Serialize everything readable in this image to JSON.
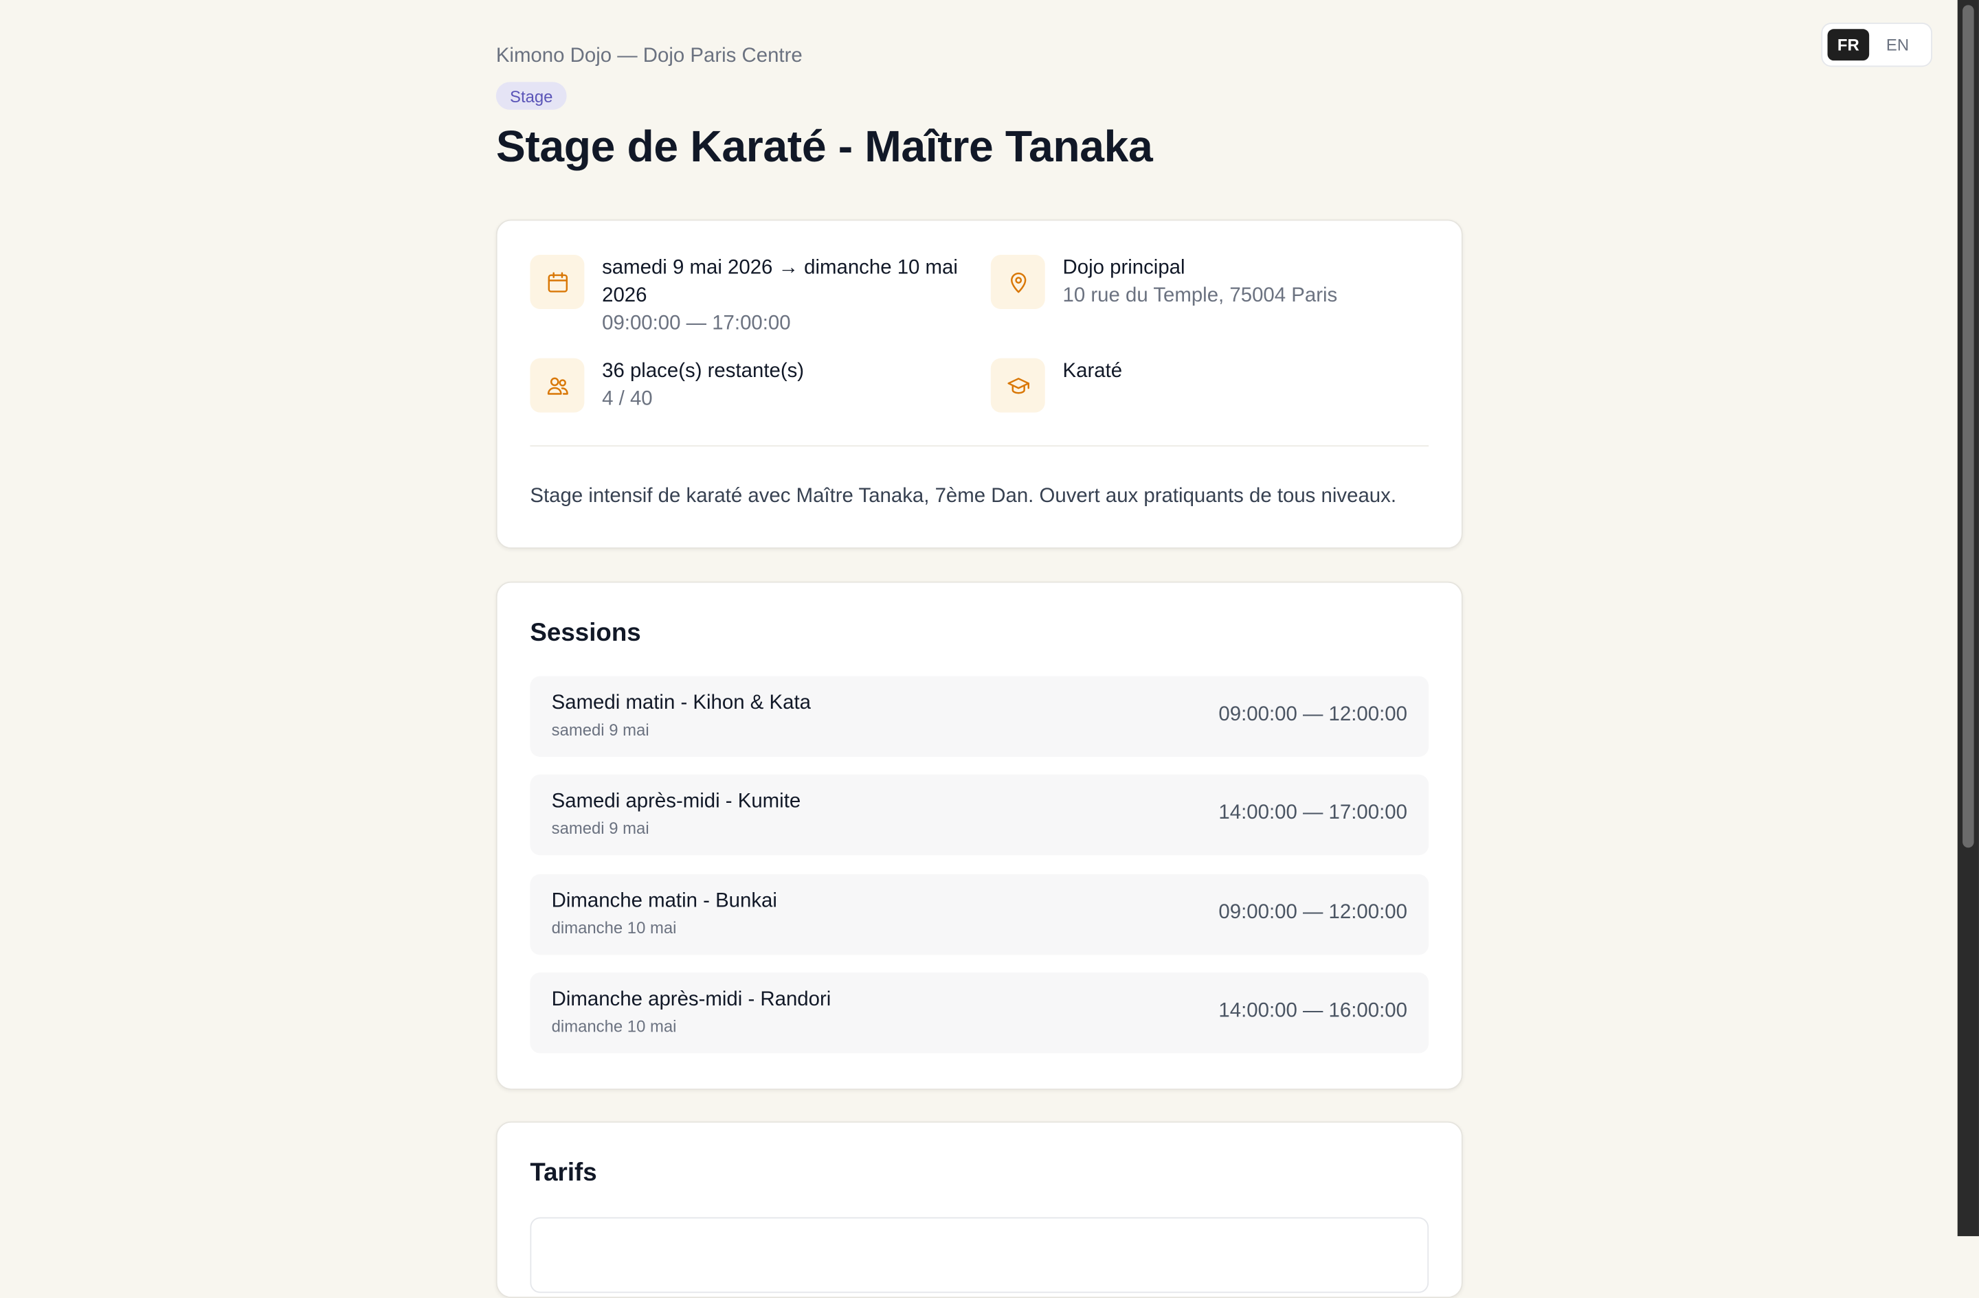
{
  "header": {
    "org": "Kimono Dojo — Dojo Paris Centre",
    "badge": "Stage",
    "title": "Stage de Karaté - Maître Tanaka"
  },
  "lang": {
    "fr": "FR",
    "en": "EN",
    "active": "FR"
  },
  "info": {
    "dates": "samedi 9 mai 2026 → dimanche 10 mai 2026",
    "hours": "09:00:00 — 17:00:00",
    "location_name": "Dojo principal",
    "location_address": "10 rue du Temple, 75004 Paris",
    "places": "36 place(s) restante(s)",
    "capacity": "4 / 40",
    "discipline": "Karaté",
    "description": "Stage intensif de karaté avec Maître Tanaka, 7ème Dan. Ouvert aux pratiquants de tous niveaux."
  },
  "sessions": {
    "title": "Sessions",
    "items": [
      {
        "name": "Samedi matin - Kihon & Kata",
        "date": "samedi 9 mai",
        "time": "09:00:00 — 12:00:00"
      },
      {
        "name": "Samedi après-midi - Kumite",
        "date": "samedi 9 mai",
        "time": "14:00:00 — 17:00:00"
      },
      {
        "name": "Dimanche matin - Bunkai",
        "date": "dimanche 10 mai",
        "time": "09:00:00 — 12:00:00"
      },
      {
        "name": "Dimanche après-midi - Randori",
        "date": "dimanche 10 mai",
        "time": "14:00:00 — 16:00:00"
      }
    ]
  },
  "tarifs": {
    "title": "Tarifs"
  },
  "icons": {
    "dates": "calendar-icon",
    "location": "map-pin-icon",
    "places": "users-icon",
    "discipline": "graduation-cap-icon"
  },
  "colors": {
    "background": "#f8f6ef",
    "icon": "#d97706",
    "badge_bg": "#e5e4f5",
    "badge_text": "#5b55b8"
  }
}
